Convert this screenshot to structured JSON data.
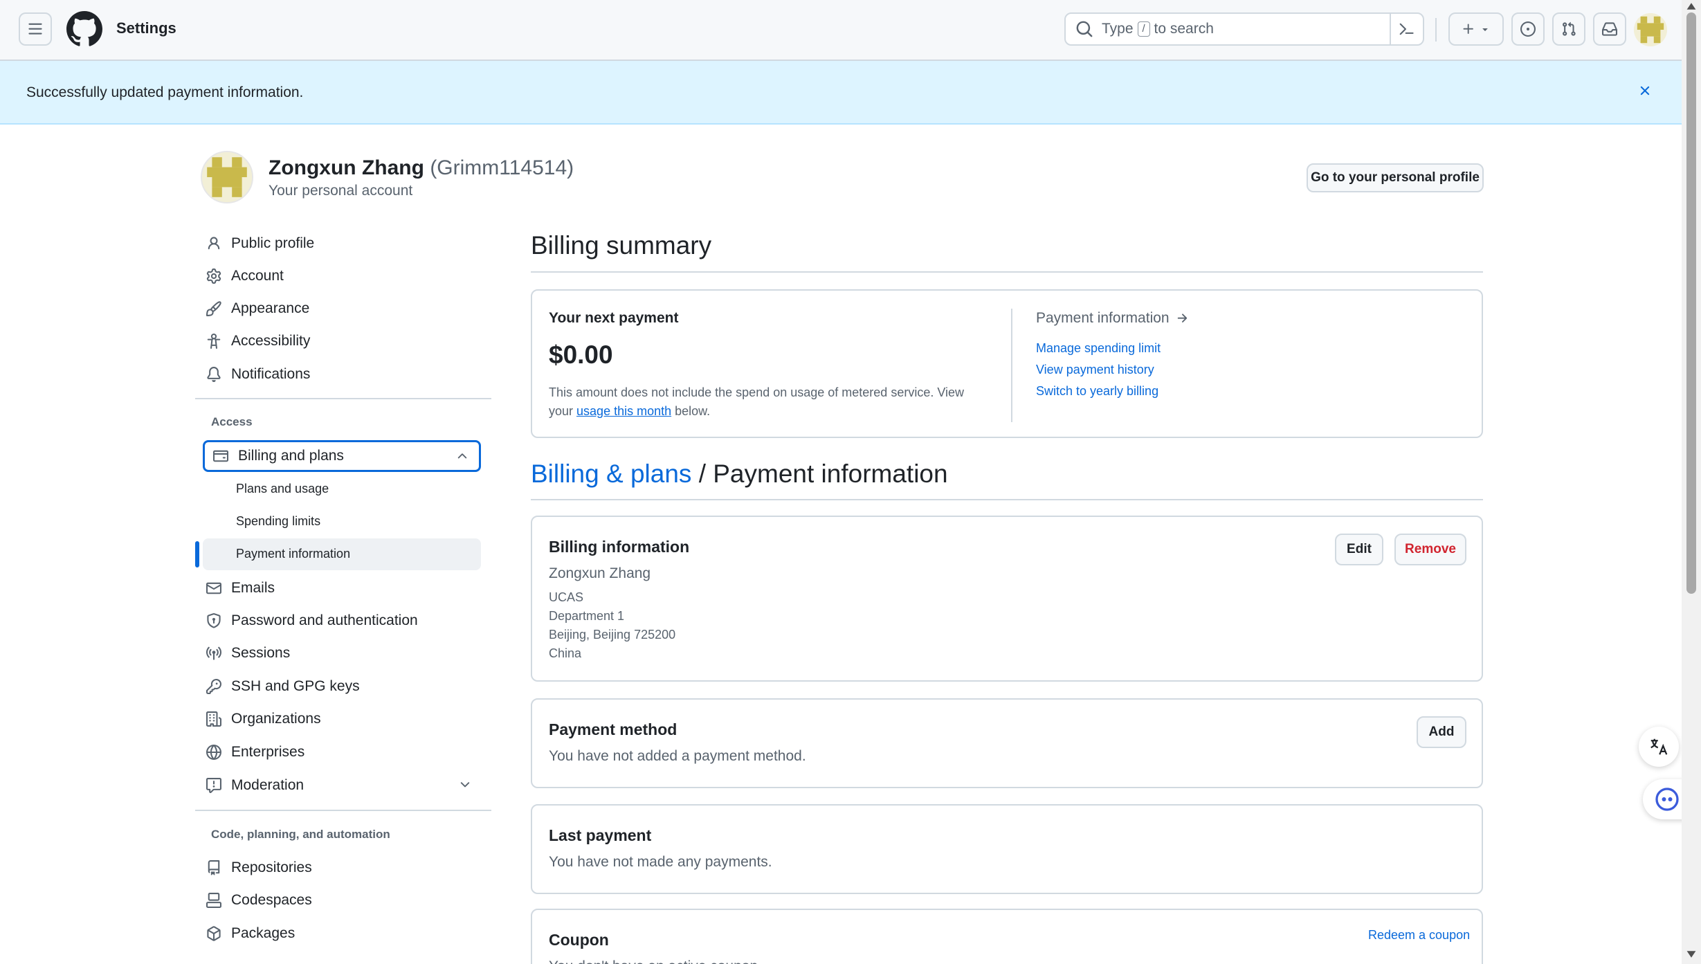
{
  "header": {
    "title": "Settings",
    "search_prefix": "Type",
    "search_key": "/",
    "search_suffix": "to search"
  },
  "flash": {
    "message": "Successfully updated payment information."
  },
  "profile": {
    "name": "Zongxun Zhang",
    "login": "(Grimm114514)",
    "subtitle": "Your personal account",
    "go_profile_label": "Go to your personal profile"
  },
  "sidebar": {
    "items_top": [
      {
        "label": "Public profile",
        "icon": "person-icon"
      },
      {
        "label": "Account",
        "icon": "gear-icon"
      },
      {
        "label": "Appearance",
        "icon": "paintbrush-icon"
      },
      {
        "label": "Accessibility",
        "icon": "accessibility-icon"
      },
      {
        "label": "Notifications",
        "icon": "bell-icon"
      }
    ],
    "access_heading": "Access",
    "billing_label": "Billing and plans",
    "billing_sub": [
      "Plans and usage",
      "Spending limits",
      "Payment information"
    ],
    "items_access": [
      {
        "label": "Emails",
        "icon": "mail-icon"
      },
      {
        "label": "Password and authentication",
        "icon": "shield-lock-icon"
      },
      {
        "label": "Sessions",
        "icon": "broadcast-icon"
      },
      {
        "label": "SSH and GPG keys",
        "icon": "key-icon"
      },
      {
        "label": "Organizations",
        "icon": "organization-icon"
      },
      {
        "label": "Enterprises",
        "icon": "globe-icon"
      },
      {
        "label": "Moderation",
        "icon": "report-icon"
      }
    ],
    "code_heading": "Code, planning, and automation",
    "items_code": [
      {
        "label": "Repositories",
        "icon": "repo-icon"
      },
      {
        "label": "Codespaces",
        "icon": "codespaces-icon"
      },
      {
        "label": "Packages",
        "icon": "package-icon"
      }
    ]
  },
  "billing_summary": {
    "heading": "Billing summary",
    "next_payment_label": "Your next payment",
    "amount": "$0.00",
    "note_before": "This amount does not include the spend on usage of metered service. View your",
    "note_link": "usage this month",
    "note_after": "below.",
    "payment_info_label": "Payment information",
    "links": [
      "Manage spending limit",
      "View payment history",
      "Switch to yearly billing"
    ]
  },
  "breadcrumb": {
    "parent": "Billing & plans",
    "separator": "/",
    "current": "Payment information"
  },
  "billing_info": {
    "title": "Billing information",
    "name": "Zongxun Zhang",
    "address": [
      "UCAS",
      "Department 1",
      "Beijing, Beijing 725200",
      "China"
    ],
    "edit_label": "Edit",
    "remove_label": "Remove"
  },
  "payment_method": {
    "title": "Payment method",
    "text": "You have not added a payment method.",
    "add_label": "Add"
  },
  "last_payment": {
    "title": "Last payment",
    "text": "You have not made any payments."
  },
  "coupon": {
    "title": "Coupon",
    "text": "You don't have an active coupon.",
    "redeem_label": "Redeem a coupon"
  },
  "colors": {
    "accent": "#0969da",
    "danger": "#d1242f",
    "flash_bg": "#ddf4ff"
  }
}
